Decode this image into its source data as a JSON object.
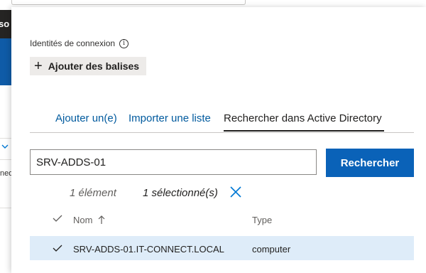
{
  "background": {
    "left_strip_text": "so",
    "left_fragment_text": "ned"
  },
  "panel": {
    "identity_label": "Identités de connexion",
    "info_icon_glyph": "i",
    "add_tags_label": "Ajouter des balises",
    "tabs": [
      {
        "label": "Ajouter un(e)",
        "active": false
      },
      {
        "label": "Importer une liste",
        "active": false
      },
      {
        "label": "Rechercher dans Active Directory",
        "active": true
      }
    ],
    "search": {
      "value": "SRV-ADDS-01",
      "button_label": "Rechercher"
    },
    "summary": {
      "count_text": "1 élément",
      "selected_text": "1 sélectionné(s)"
    },
    "table": {
      "columns": [
        "Nom",
        "Type"
      ],
      "rows": [
        {
          "name": "SRV-ADDS-01.IT-CONNECT.LOCAL",
          "type": "computer",
          "selected": true
        }
      ]
    }
  },
  "colors": {
    "accent": "#0a62b8",
    "link": "#005a9e",
    "row_selected": "#deecf9",
    "add_tags_bg": "#edebe9"
  }
}
